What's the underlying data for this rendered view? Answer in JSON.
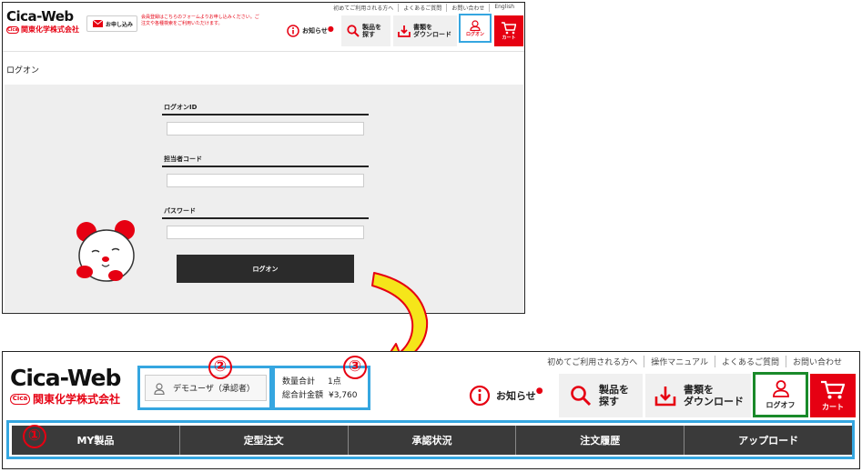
{
  "top_panel": {
    "utility_links": [
      "初めてご利用される方へ",
      "よくあるご質問",
      "お問い合わせ",
      "English"
    ],
    "logo_text": "Cica-Web",
    "logo_badge": "Cica",
    "company_name": "関東化学株式会社",
    "apply_label": "お申し込み",
    "notice_text": "会員登録はこちらのフォームよりお申し込みください。ご注文や各種検索をご利用いただけます。",
    "notices_label": "お知らせ",
    "search_label_1": "製品を",
    "search_label_2": "探す",
    "docs_label_1": "書類を",
    "docs_label_2": "ダウンロード",
    "logon_label": "ログオン",
    "cart_label": "カート",
    "page_title": "ログオン",
    "form": {
      "logon_id_label": "ログオンID",
      "staff_code_label": "担当者コード",
      "password_label": "パスワード",
      "submit_label": "ログオン"
    }
  },
  "bottom_panel": {
    "utility_links": [
      "初めてご利用される方へ",
      "操作マニュアル",
      "よくあるご質問",
      "お問い合わせ"
    ],
    "logo_text": "Cica-Web",
    "logo_badge": "Cica",
    "company_name": "関東化学株式会社",
    "user_label": "デモユーザ（承認者）",
    "qty_label": "数量合計",
    "qty_value": "1点",
    "total_label": "総合計金額",
    "total_value": "¥3,760",
    "notices_label": "お知らせ",
    "search_label_1": "製品を",
    "search_label_2": "探す",
    "docs_label_1": "書類を",
    "docs_label_2": "ダウンロード",
    "logoff_label": "ログオフ",
    "cart_label": "カート",
    "nav_items": [
      "MY製品",
      "定型注文",
      "承認状況",
      "注文履歴",
      "アップロード"
    ]
  },
  "annotations": {
    "marker_1": "①",
    "marker_2": "②",
    "marker_3": "③"
  },
  "colors": {
    "brand_red": "#e60012",
    "highlight_blue": "#35a6e0",
    "highlight_green": "#1a8a2a",
    "nav_dark": "#3a3a3a",
    "arrow_yellow": "#f5e51a"
  }
}
